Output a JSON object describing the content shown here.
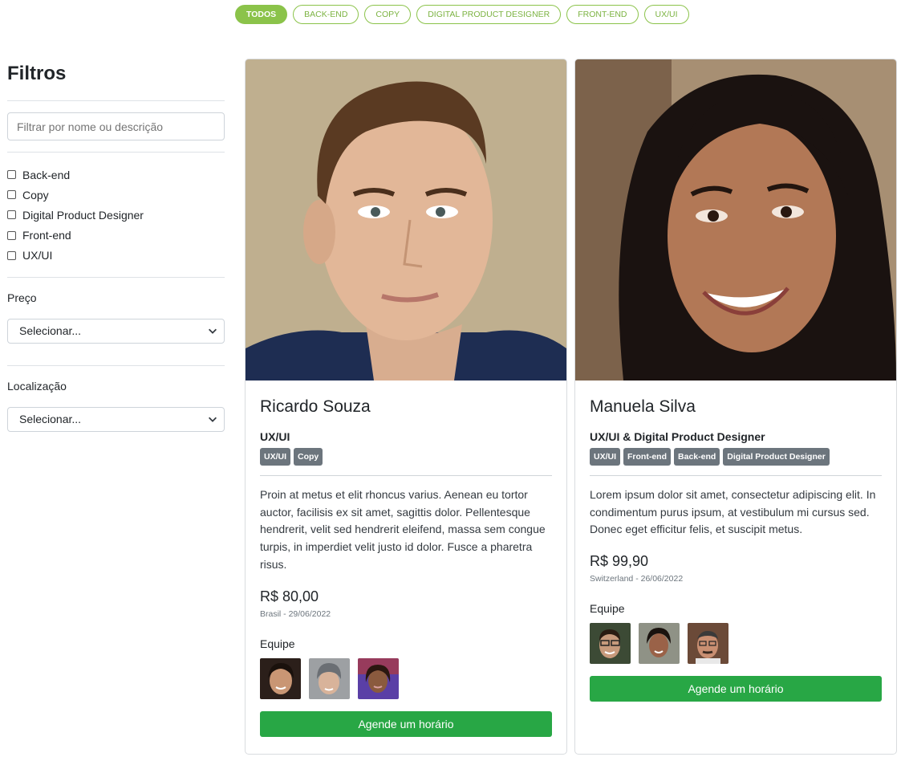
{
  "categories": [
    {
      "label": "Todos",
      "active": true
    },
    {
      "label": "Back-end",
      "active": false
    },
    {
      "label": "Copy",
      "active": false
    },
    {
      "label": "Digital Product Designer",
      "active": false
    },
    {
      "label": "Front-end",
      "active": false
    },
    {
      "label": "UX/UI",
      "active": false
    }
  ],
  "sidebar": {
    "title": "Filtros",
    "search_placeholder": "Filtrar por nome ou descrição",
    "checkboxes": [
      "Back-end",
      "Copy",
      "Digital Product Designer",
      "Front-end",
      "UX/UI"
    ],
    "price_label": "Preço",
    "price_value": "Selecionar...",
    "location_label": "Localização",
    "location_value": "Selecionar..."
  },
  "cards": [
    {
      "name": "Ricardo Souza",
      "role": "UX/UI",
      "tags": [
        "UX/UI",
        "Copy"
      ],
      "description": "Proin at metus et elit rhoncus varius. Aenean eu tortor auctor, facilisis ex sit amet, sagittis dolor. Pellentesque hendrerit, velit sed hendrerit eleifend, massa sem congue turpis, in imperdiet velit justo id dolor. Fusce a pharetra risus.",
      "price": "R$ 80,00",
      "location": "Brasil - 29/06/2022",
      "team_label": "Equipe",
      "cta": "Agende um horário"
    },
    {
      "name": "Manuela Silva",
      "role": "UX/UI & Digital Product Designer",
      "tags": [
        "UX/UI",
        "Front-end",
        "Back-end",
        "Digital Product Designer"
      ],
      "description": "Lorem ipsum dolor sit amet, consectetur adipiscing elit. In condimentum purus ipsum, at vestibulum mi cursus sed. Donec eget efficitur felis, et suscipit metus.",
      "price": "R$ 99,90",
      "location": "Switzerland - 26/06/2022",
      "team_label": "Equipe",
      "cta": "Agende um horário"
    }
  ],
  "colors": {
    "accent": "#8bc34a",
    "cta": "#28a745",
    "tag": "#6c757d"
  }
}
